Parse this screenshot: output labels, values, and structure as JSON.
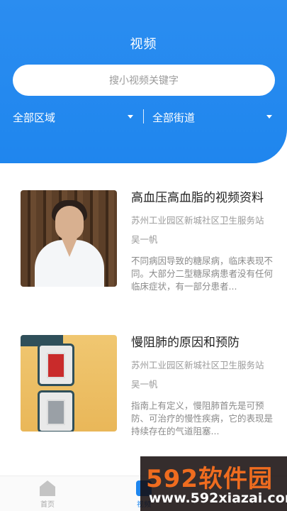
{
  "header": {
    "title": "视频",
    "search_placeholder": "搜小视频关键字",
    "filters": [
      {
        "label": "全部区域"
      },
      {
        "label": "全部街道"
      }
    ]
  },
  "videos": [
    {
      "title": "高血压高血脂的视频资料",
      "org": "苏州工业园区新城社区卫生服务站",
      "author": "吴一帆",
      "description": "不同病因导致的糖尿病，临床表现不同。大部分二型糖尿病患者没有任何临床症状，有一部分患者..."
    },
    {
      "title": "慢阻肺的原因和预防",
      "org": "苏州工业园区新城社区卫生服务站",
      "author": "吴一帆",
      "description": "指南上有定义，慢阻肺首先是可预防、可治疗的慢性疾病，它的表现是持续存在的气道阻塞..."
    }
  ],
  "tabbar": {
    "items": [
      {
        "label": "首页"
      },
      {
        "label": "视频"
      }
    ]
  },
  "watermark": {
    "main": "592软件园",
    "sub": "www.592xiazai.com"
  },
  "colors": {
    "primary": "#1f86ee",
    "watermark_accent": "#ef6c1f"
  }
}
